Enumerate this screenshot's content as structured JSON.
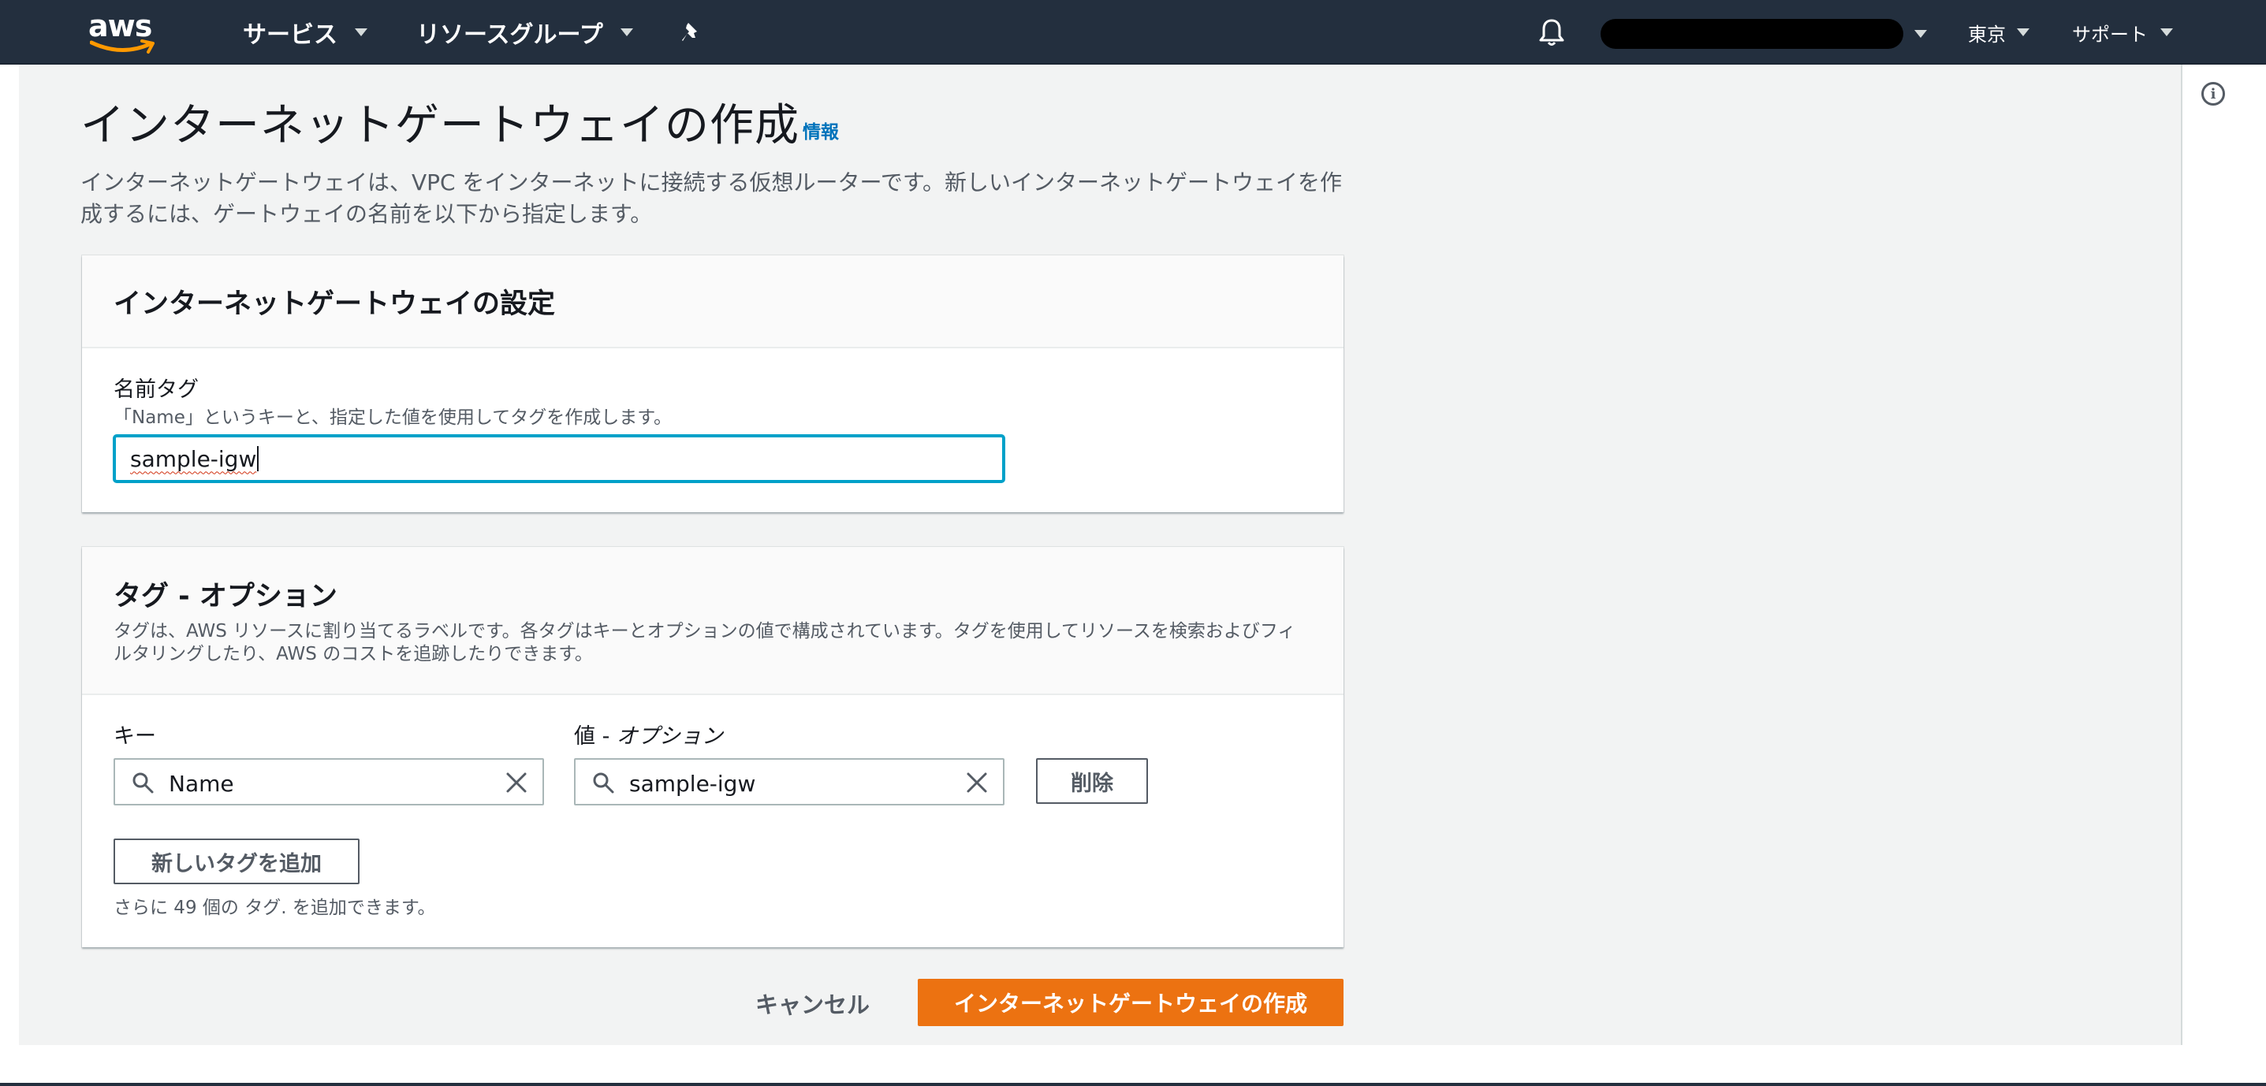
{
  "nav": {
    "logo_text": "aws",
    "services_label": "サービス",
    "resource_groups_label": "リソースグループ",
    "region_label": "東京",
    "support_label": "サポート"
  },
  "page": {
    "title": "インターネットゲートウェイの作成",
    "info_link": "情報",
    "description": "インターネットゲートウェイは、VPC をインターネットに接続する仮想ルーターです。新しいインターネットゲートウェイを作成するには、ゲートウェイの名前を以下から指定します。"
  },
  "settings_panel": {
    "title": "インターネットゲートウェイの設定",
    "name_tag_label": "名前タグ",
    "name_tag_desc": "「Name」というキーと、指定した値を使用してタグを作成します。",
    "name_tag_value": "sample-igw"
  },
  "tags_panel": {
    "title": "タグ - オプション",
    "description": "タグは、AWS リソースに割り当てるラベルです。各タグはキーとオプションの値で構成されています。タグを使用してリソースを検索およびフィルタリングしたり、AWS のコストを追跡したりできます。",
    "key_label": "キー",
    "value_label_prefix": "値 - ",
    "value_label_suffix": "オプション",
    "key_value": "Name",
    "value_value": "sample-igw",
    "remove_button": "削除",
    "add_tag_button": "新しいタグを追加",
    "remaining_hint": "さらに 49 個の タグ. を追加できます。"
  },
  "footer": {
    "cancel_label": "キャンセル",
    "create_button": "インターネットゲートウェイの作成"
  },
  "colors": {
    "nav_bg": "#232f3e",
    "primary": "#ec7211",
    "link": "#0073bb",
    "focus": "#00a1c9",
    "page_bg": "#f2f3f3"
  },
  "icons": [
    "pin-icon",
    "bell-icon",
    "info-icon",
    "search-icon",
    "clear-icon",
    "chevron-down-icon"
  ]
}
